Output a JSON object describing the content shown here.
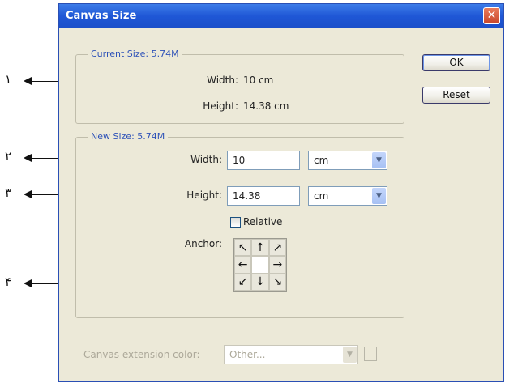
{
  "callouts": [
    "١",
    "٢",
    "٣",
    "۴"
  ],
  "dialog": {
    "title": "Canvas Size",
    "close_glyph": "✕"
  },
  "buttons": {
    "ok": "OK",
    "reset": "Reset"
  },
  "current_size": {
    "legend": "Current Size: 5.74M",
    "width_label": "Width:",
    "width_value": "10 cm",
    "height_label": "Height:",
    "height_value": "14.38 cm"
  },
  "new_size": {
    "legend": "New Size: 5.74M",
    "width_label": "Width:",
    "width_value": "10",
    "width_unit": "cm",
    "height_label": "Height:",
    "height_value": "14.38",
    "height_unit": "cm",
    "relative_label": "Relative",
    "relative_checked": false,
    "anchor_label": "Anchor:",
    "anchor_arrows": [
      "↖",
      "↑",
      "↗",
      "←",
      "",
      "→",
      "↙",
      "↓",
      "↘"
    ]
  },
  "extension": {
    "label": "Canvas extension color:",
    "value": "Other..."
  },
  "icons": {
    "dropdown": "chevron-down-icon",
    "close": "close-icon"
  },
  "colors": {
    "titlebar": "#1f57d6",
    "dialog_bg": "#ece9d8",
    "legend_text": "#2e52b8"
  }
}
